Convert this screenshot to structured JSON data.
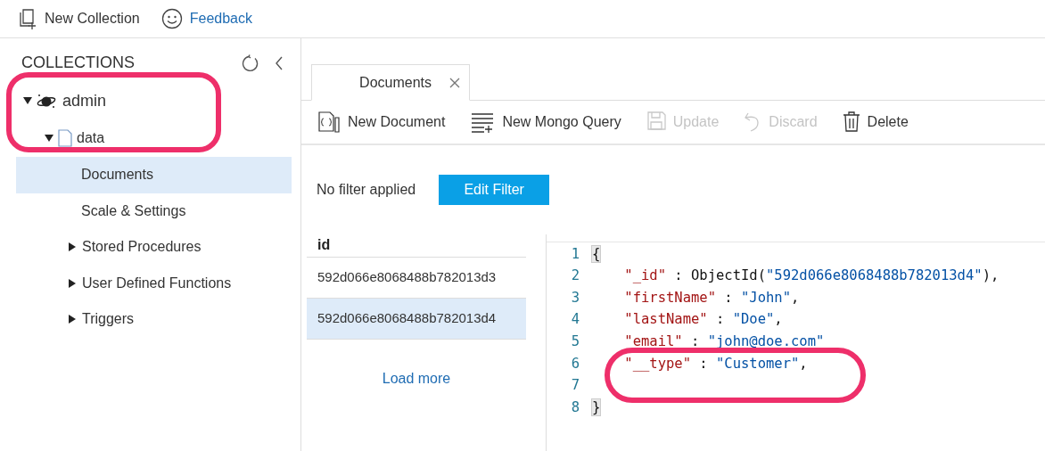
{
  "top_bar": [
    {
      "kind": "new-collection",
      "label": "New Collection"
    },
    {
      "kind": "feedback",
      "label": "Feedback"
    }
  ],
  "sidebar": {
    "title": "COLLECTIONS",
    "tree": [
      {
        "label": "admin",
        "kind": "database",
        "expanded": true,
        "children": [
          {
            "label": "data",
            "kind": "collection",
            "expanded": true,
            "children": [
              {
                "label": "Documents",
                "selected": true
              },
              {
                "label": "Scale & Settings",
                "selected": false
              },
              {
                "label": "Stored Procedures",
                "selected": false,
                "expanded": false
              },
              {
                "label": "User Defined Functions",
                "selected": false,
                "expanded": false
              },
              {
                "label": "Triggers",
                "selected": false,
                "expanded": false
              }
            ]
          }
        ]
      }
    ]
  },
  "tabs": [
    {
      "label": "Documents",
      "selected": true
    }
  ],
  "toolbar": [
    {
      "kind": "new-document",
      "label": "New Document",
      "disabled": false
    },
    {
      "kind": "new-query",
      "label": "New Mongo Query",
      "disabled": false
    },
    {
      "kind": "update",
      "label": "Update",
      "disabled": true
    },
    {
      "kind": "discard",
      "label": "Discard",
      "disabled": true
    },
    {
      "kind": "delete",
      "label": "Delete",
      "disabled": false
    }
  ],
  "filter": {
    "status": "No filter applied",
    "button": "Edit Filter"
  },
  "id_list": {
    "column": "id",
    "rows": [
      {
        "id": "592d066e8068488b782013d3",
        "selected": false
      },
      {
        "id": "592d066e8068488b782013d4",
        "selected": true
      }
    ],
    "load_more": "Load more"
  },
  "editor": {
    "lines": [
      {
        "number": "1",
        "tokens": [
          {
            "kind": "bracket",
            "text": "{"
          }
        ]
      },
      {
        "number": "2",
        "tokens": [
          {
            "kind": "key",
            "text": "    \"_id\""
          },
          {
            "kind": "plain",
            "text": " : ObjectId("
          },
          {
            "kind": "string",
            "text": "\"592d066e8068488b782013d4\""
          },
          {
            "kind": "plain",
            "text": "),"
          }
        ]
      },
      {
        "number": "3",
        "tokens": [
          {
            "kind": "key",
            "text": "    \"firstName\""
          },
          {
            "kind": "plain",
            "text": " : "
          },
          {
            "kind": "string",
            "text": "\"John\""
          },
          {
            "kind": "plain",
            "text": ","
          }
        ]
      },
      {
        "number": "4",
        "tokens": [
          {
            "kind": "key",
            "text": "    \"lastName\""
          },
          {
            "kind": "plain",
            "text": " : "
          },
          {
            "kind": "string",
            "text": "\"Doe\""
          },
          {
            "kind": "plain",
            "text": ","
          }
        ]
      },
      {
        "number": "5",
        "tokens": [
          {
            "kind": "key",
            "text": "    \"email\""
          },
          {
            "kind": "plain",
            "text": " : "
          },
          {
            "kind": "string",
            "text": "\"john@doe.com\""
          }
        ]
      },
      {
        "number": "6",
        "tokens": [
          {
            "kind": "key",
            "text": "    \"__type\""
          },
          {
            "kind": "plain",
            "text": " : "
          },
          {
            "kind": "string",
            "text": "\"Customer\""
          },
          {
            "kind": "plain",
            "text": ","
          }
        ]
      },
      {
        "number": "7"
      },
      {
        "number": "8",
        "tokens": [
          {
            "kind": "bracket",
            "text": "}"
          }
        ]
      }
    ]
  }
}
